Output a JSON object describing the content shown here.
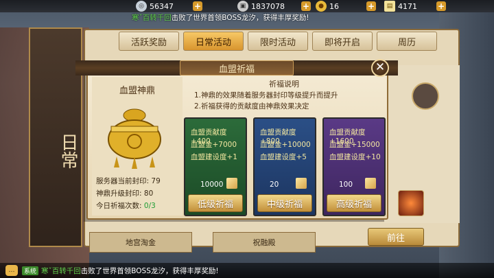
{
  "topbar": {
    "silver": "56347",
    "ingot": "1837078",
    "gold": "16",
    "scroll": "4171"
  },
  "broadcast": {
    "player": "寒ˇ百转千回",
    "message": "击败了世界首领BOSS龙汐，获得丰厚奖励!"
  },
  "banner_text": "日常",
  "tabs": [
    "活跃奖励",
    "日常活动",
    "限时活动",
    "即将开启",
    "周历"
  ],
  "active_tab": "日常活动",
  "modal": {
    "title": "血盟祈福",
    "cauldron_name": "血盟神鼎",
    "server_seal_label": "服务器当前封印:",
    "server_seal_value": "79",
    "upgrade_seal_label": "神鼎升级封印:",
    "upgrade_seal_value": "80",
    "today_count_label": "今日祈福次数:",
    "today_count_value": "0/3",
    "desc_title": "祈福说明",
    "desc_lines": [
      "1.神鼎的效果随着服务器封印等级提升而提升",
      "2.祈福获得的贡献度由神鼎效果决定"
    ],
    "tiers": [
      {
        "lines": [
          "血盟贡献度+400",
          "血盟金+7000",
          "血盟建设度+1"
        ],
        "cost": "10000",
        "button": "低级祈福"
      },
      {
        "lines": [
          "血盟贡献度+800",
          "血盟金+10000",
          "血盟建设度+5"
        ],
        "cost": "20",
        "button": "中级祈福"
      },
      {
        "lines": [
          "血盟贡献度+1600",
          "血盟金+15000",
          "血盟建设度+10"
        ],
        "cost": "100",
        "button": "高级祈福"
      }
    ]
  },
  "bottom_cards": [
    "地宫淘金",
    "祝融殿"
  ],
  "go_button": "前往",
  "chat": {
    "tag": "系统",
    "player": "寒ˇ百转千回",
    "message": "击败了世界首领BOSS龙汐，获得丰厚奖励!"
  },
  "colors": {
    "accent_gold": "#d79a2a",
    "highlight_green": "#61d14d",
    "tier_low": "#2c6b3a",
    "tier_mid": "#2b4f86",
    "tier_high": "#5a3a86"
  }
}
